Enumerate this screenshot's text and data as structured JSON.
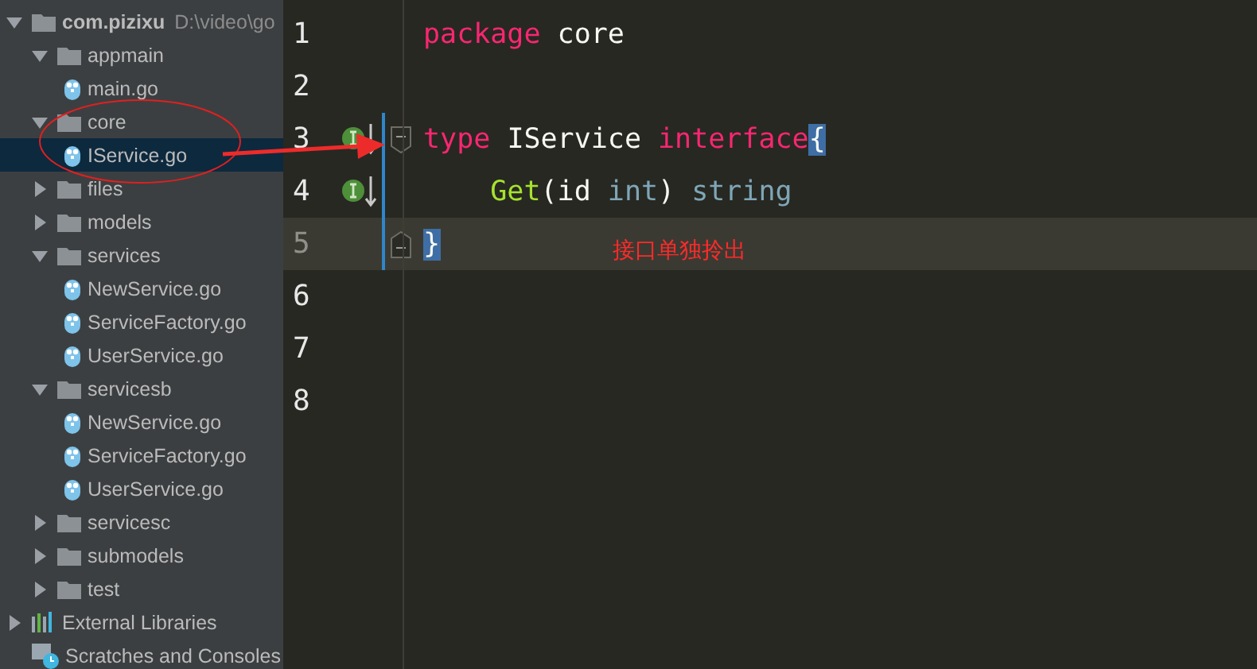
{
  "project_tree": {
    "items": [
      {
        "kind": "folder",
        "name": "com.pizixu",
        "path": "D:\\video\\go",
        "expanded": true,
        "selected": false,
        "children": [
          {
            "kind": "folder",
            "name": "appmain",
            "expanded": true,
            "selected": false,
            "children": [
              {
                "kind": "file",
                "name": "main.go",
                "selected": false
              }
            ]
          },
          {
            "kind": "folder",
            "name": "core",
            "expanded": true,
            "selected": false,
            "children": [
              {
                "kind": "file",
                "name": "IService.go",
                "selected": true
              }
            ]
          },
          {
            "kind": "folder",
            "name": "files",
            "expanded": false,
            "selected": false
          },
          {
            "kind": "folder",
            "name": "models",
            "expanded": false,
            "selected": false
          },
          {
            "kind": "folder",
            "name": "services",
            "expanded": true,
            "selected": false,
            "children": [
              {
                "kind": "file",
                "name": "NewService.go",
                "selected": false
              },
              {
                "kind": "file",
                "name": "ServiceFactory.go",
                "selected": false
              },
              {
                "kind": "file",
                "name": "UserService.go",
                "selected": false
              }
            ]
          },
          {
            "kind": "folder",
            "name": "servicesb",
            "expanded": true,
            "selected": false,
            "children": [
              {
                "kind": "file",
                "name": "NewService.go",
                "selected": false
              },
              {
                "kind": "file",
                "name": "ServiceFactory.go",
                "selected": false
              },
              {
                "kind": "file",
                "name": "UserService.go",
                "selected": false
              }
            ]
          },
          {
            "kind": "folder",
            "name": "servicesc",
            "expanded": false,
            "selected": false
          },
          {
            "kind": "folder",
            "name": "submodels",
            "expanded": false,
            "selected": false
          },
          {
            "kind": "folder",
            "name": "test",
            "expanded": false,
            "selected": false
          }
        ]
      },
      {
        "kind": "library",
        "name": "External Libraries",
        "expanded": false,
        "selected": false
      },
      {
        "kind": "scratches",
        "name": "Scratches and Consoles",
        "selected": false
      }
    ]
  },
  "editor": {
    "lines": [
      {
        "number": "1",
        "current": false,
        "tokens": [
          {
            "kind": "keyword",
            "text": "package "
          },
          {
            "kind": "plain",
            "text": "core"
          }
        ]
      },
      {
        "number": "2",
        "current": false
      },
      {
        "number": "3",
        "current": false,
        "implemented": true,
        "fold_start": true,
        "tokens": [
          {
            "kind": "keyword",
            "text": "type "
          },
          {
            "kind": "plain",
            "text": "IService "
          },
          {
            "kind": "keyword",
            "text": "interface"
          },
          {
            "kind": "brace",
            "text": "{"
          }
        ]
      },
      {
        "number": "4",
        "current": false,
        "implemented": true,
        "tokens": [
          {
            "kind": "func",
            "text": "    Get"
          },
          {
            "kind": "plain",
            "text": "(id "
          },
          {
            "kind": "type",
            "text": "int"
          },
          {
            "kind": "plain",
            "text": ") "
          },
          {
            "kind": "type",
            "text": "string"
          }
        ]
      },
      {
        "number": "5",
        "current": true,
        "fold_end": true,
        "tokens": [
          {
            "kind": "brace",
            "text": "}"
          }
        ]
      },
      {
        "number": "6",
        "current": false
      },
      {
        "number": "7",
        "current": false
      },
      {
        "number": "8",
        "current": false
      }
    ]
  },
  "annotation": {
    "note": "接口单独拎出"
  }
}
